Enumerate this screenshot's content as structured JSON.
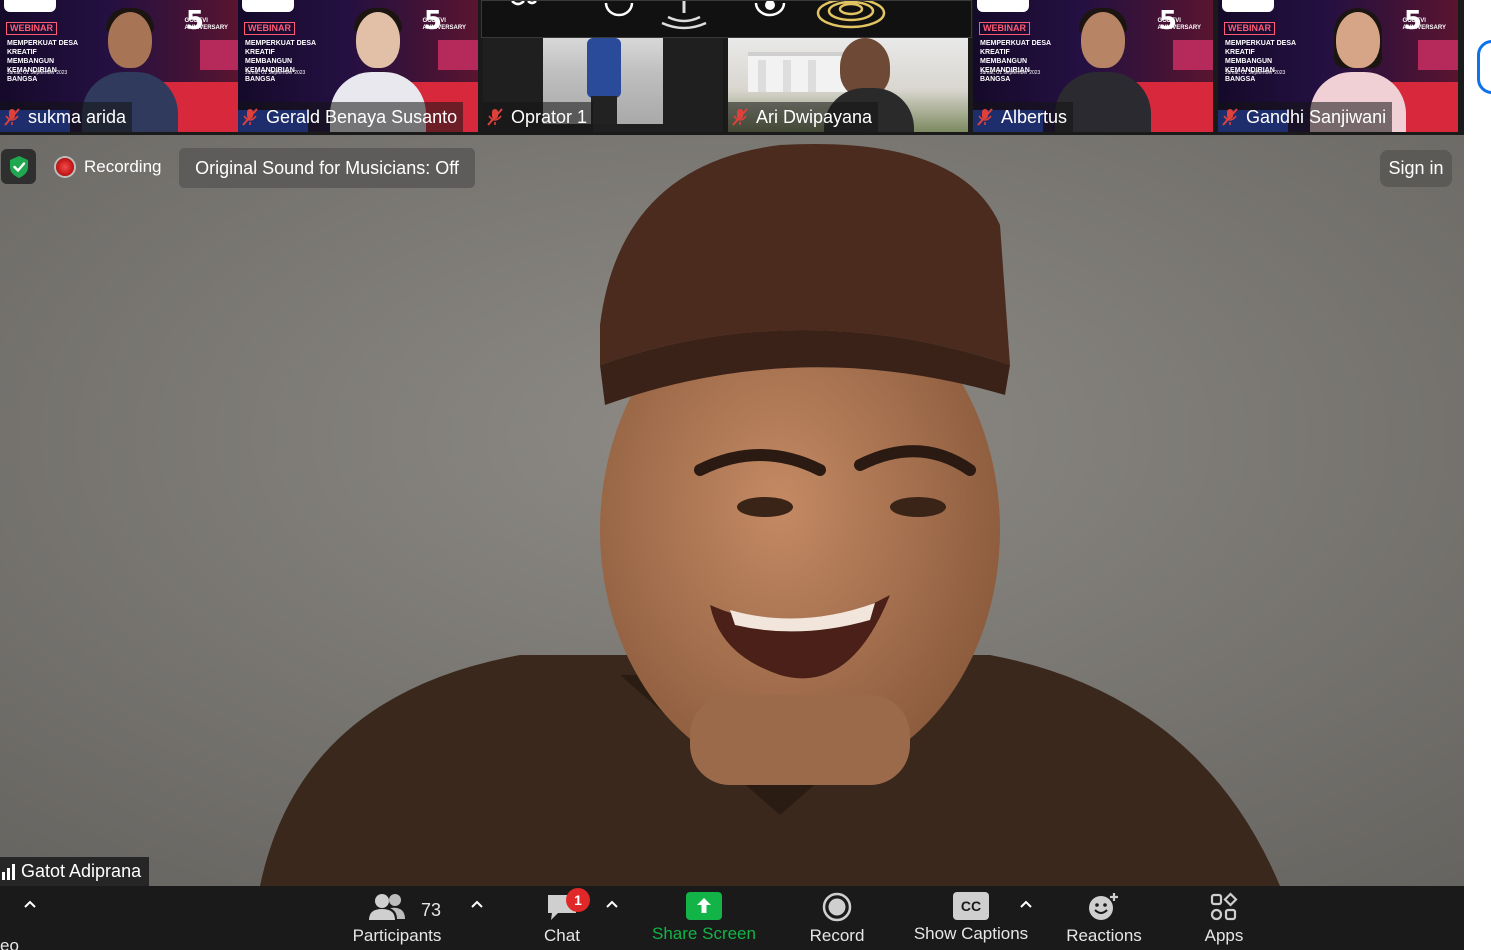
{
  "webinar": {
    "tag": "WEBINAR",
    "title_lines": "MEMPERKUAT DESA KREATIF\nMEMBANGUN KEMANDIRIAN\nBANGSA",
    "date": "Jumat, 01 September 2023",
    "anniversary_number": "5",
    "anniversary_text": "GODEVI\nANNIVERSARY"
  },
  "participants": [
    {
      "name": "sukma arida"
    },
    {
      "name": "Gerald Benaya Susanto"
    },
    {
      "name": "Oprator 1"
    },
    {
      "name": "Ari Dwipayana"
    },
    {
      "name": "Albertus"
    },
    {
      "name": "Gandhi Sanjiwani"
    }
  ],
  "status": {
    "recording_label": "Recording",
    "original_sound_label": "Original Sound for Musicians: Off",
    "sign_in_label": "Sign in"
  },
  "active_speaker": {
    "name": "Gatot Adiprana"
  },
  "toolbar": {
    "left_label_fragment": "eo",
    "participants_label": "Participants",
    "participants_count": "73",
    "chat_label": "Chat",
    "chat_badge": "1",
    "share_label": "Share Screen",
    "record_label": "Record",
    "captions_label": "Show Captions",
    "captions_icon_text": "CC",
    "reactions_label": "Reactions",
    "apps_label": "Apps"
  },
  "colors": {
    "toolbar_bg": "#1a1a1a",
    "share_green": "#12b347",
    "mute_red": "#e0403a",
    "badge_red": "#e02828",
    "shield_green": "#1fa84f",
    "accent_blue": "#0e72ed"
  }
}
